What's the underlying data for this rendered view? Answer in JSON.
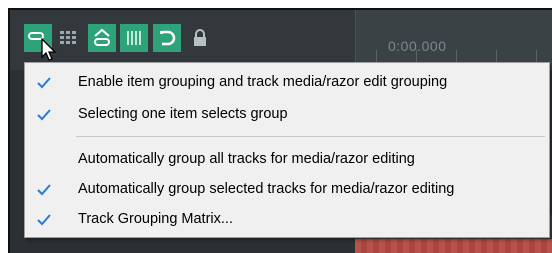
{
  "toolbar": {
    "timeline_time": "0:00.000",
    "buttons": [
      {
        "icon": "item-grouping-icon",
        "active": true
      },
      {
        "icon": "grid-icon",
        "active": false
      },
      {
        "icon": "media-grouping-icon",
        "active": true
      },
      {
        "icon": "grouping-matrix-icon",
        "active": true
      },
      {
        "icon": "loop-icon",
        "active": true
      },
      {
        "icon": "lock-icon",
        "active": false
      }
    ]
  },
  "menu": {
    "items": [
      {
        "label": "Enable item grouping and track media/razor edit grouping",
        "checked": true
      },
      {
        "label": "Selecting one item selects group",
        "checked": true
      },
      {
        "label": "Automatically group all tracks for media/razor editing",
        "checked": false
      },
      {
        "label": "Automatically group selected tracks for media/razor editing",
        "checked": true
      },
      {
        "label": "Track Grouping Matrix...",
        "checked": true
      }
    ]
  },
  "colors": {
    "active_button": "#2ea37a",
    "check_mark": "#2a7ad4",
    "menu_background": "#f0f0f0"
  }
}
